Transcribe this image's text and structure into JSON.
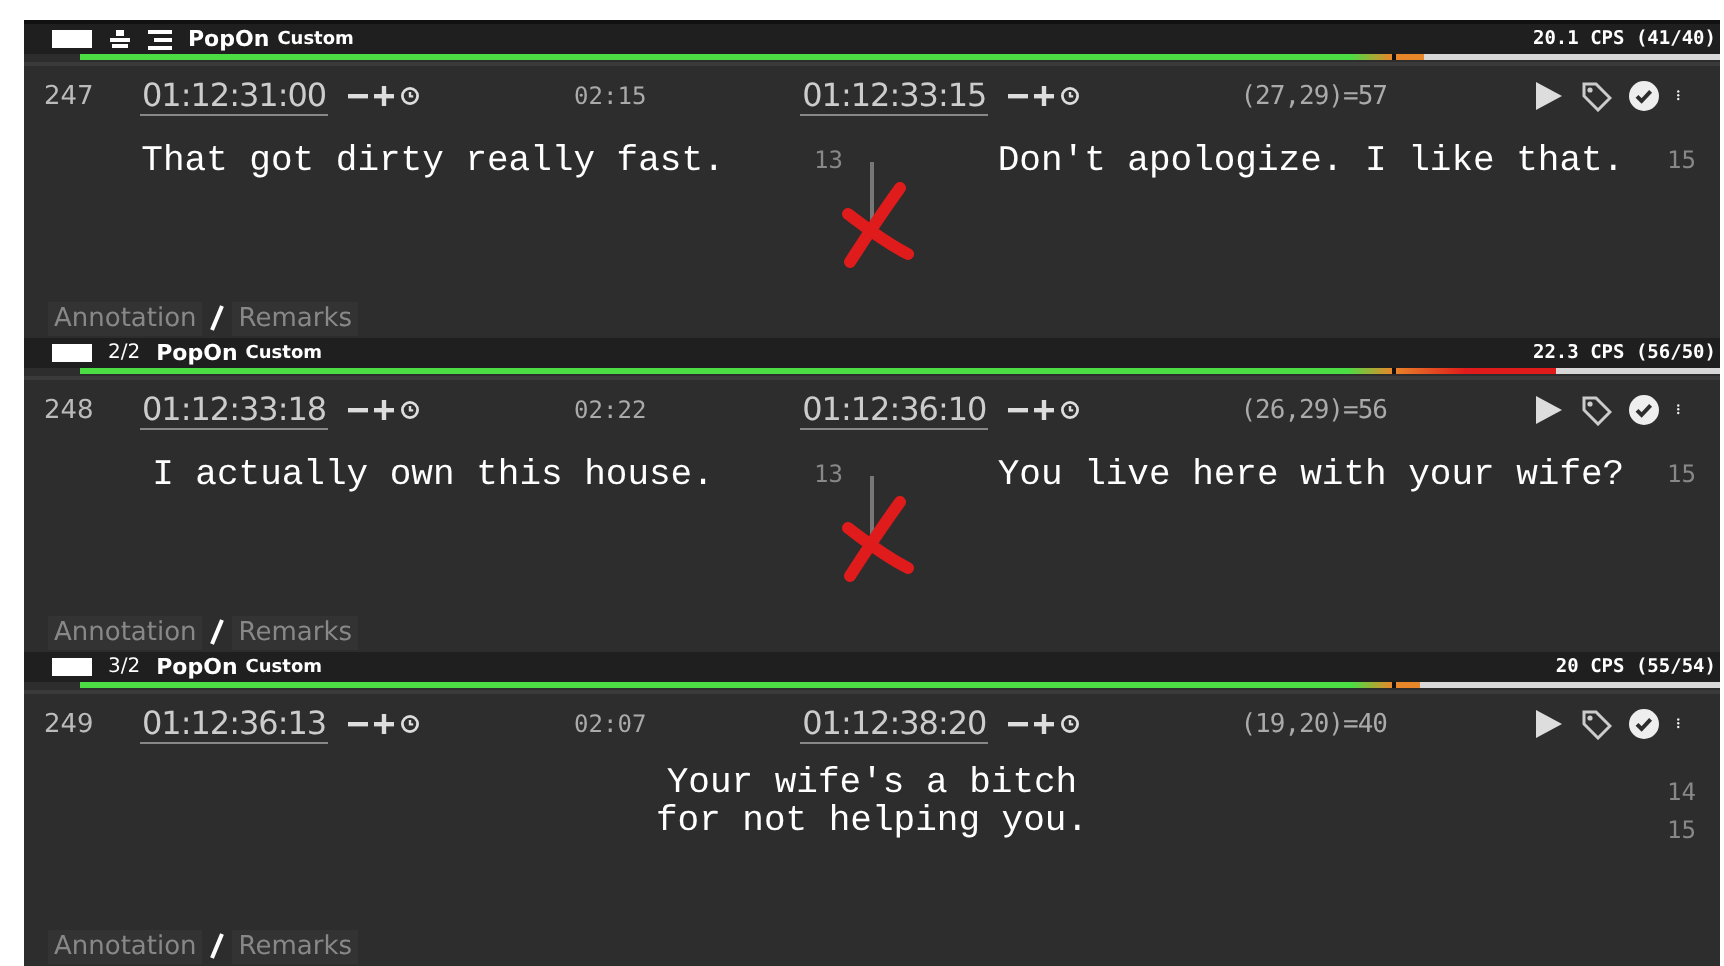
{
  "blocks": [
    {
      "header": {
        "kind": "icons",
        "type": "PopOn",
        "style": "Custom",
        "cps": "20.1 CPS (41/40)",
        "level": 0.82
      },
      "row": {
        "number": "247",
        "start": "01:12:31:00",
        "duration": "02:15",
        "end": "01:12:33:15",
        "chars": "(27,29)=57"
      },
      "subtitle": {
        "kind": "split",
        "left": "That got dirty really fast.",
        "left_count": "13",
        "right": "Don't apologize. I like that.",
        "right_count": "15",
        "flagged": true
      },
      "annotation": "Annotation",
      "remarks": "Remarks"
    },
    {
      "header": {
        "kind": "count",
        "count": "2/2",
        "type": "PopOn",
        "style": "Custom",
        "cps": "22.3 CPS (56/50)",
        "level": 0.9
      },
      "row": {
        "number": "248",
        "start": "01:12:33:18",
        "duration": "02:22",
        "end": "01:12:36:10",
        "chars": "(26,29)=56"
      },
      "subtitle": {
        "kind": "split",
        "left": "I actually own this house.",
        "left_count": "13",
        "right": "You live here with your wife?",
        "right_count": "15",
        "flagged": true
      },
      "annotation": "Annotation",
      "remarks": "Remarks"
    },
    {
      "header": {
        "kind": "count",
        "count": "3/2",
        "type": "PopOn",
        "style": "Custom",
        "cps": "20 CPS (55/54)",
        "level": 0.817
      },
      "row": {
        "number": "249",
        "start": "01:12:36:13",
        "duration": "02:07",
        "end": "01:12:38:20",
        "chars": "(19,20)=40"
      },
      "subtitle": {
        "kind": "single",
        "lines": [
          {
            "text": "Your wife's a bitch",
            "count": "14"
          },
          {
            "text": "for not helping you.",
            "count": "15"
          }
        ],
        "flagged": false
      },
      "annotation": "Annotation",
      "remarks": "Remarks"
    }
  ]
}
